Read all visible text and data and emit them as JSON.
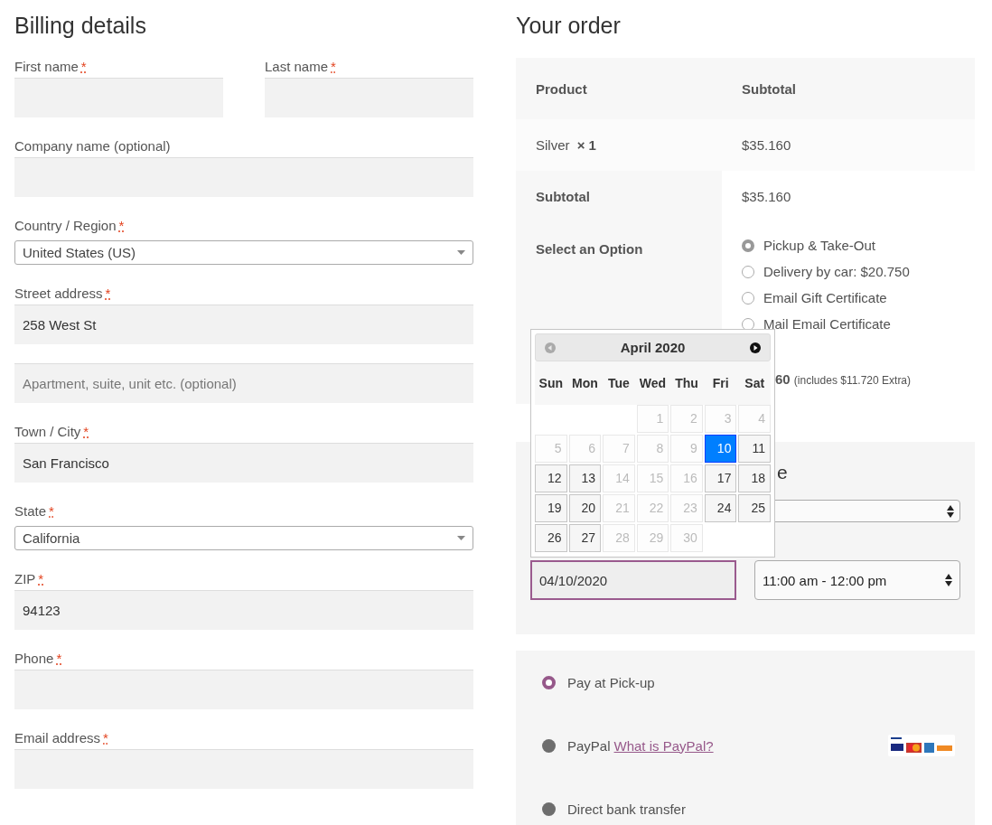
{
  "billing": {
    "title": "Billing details",
    "rows": [
      {
        "fields": [
          {
            "label": "First name",
            "required_mark": "*",
            "kind": "text"
          },
          {
            "label": "Last name",
            "required_mark": "*",
            "kind": "text"
          }
        ]
      },
      {
        "fields": [
          {
            "label": "Company name (optional)",
            "kind": "text"
          }
        ]
      },
      {
        "fields": [
          {
            "label": "Country / Region",
            "required_mark": "*",
            "kind": "select",
            "value": "United States (US)"
          }
        ]
      },
      {
        "fields": [
          {
            "label": "Street address",
            "required_mark": "*",
            "kind": "text",
            "value": "258 West St"
          }
        ]
      },
      {
        "fields": [
          {
            "kind": "text",
            "placeholder": "Apartment, suite, unit etc. (optional)"
          }
        ]
      },
      {
        "fields": [
          {
            "label": "Town / City",
            "required_mark": "*",
            "kind": "text",
            "value": "San Francisco"
          }
        ]
      },
      {
        "fields": [
          {
            "label": "State",
            "required_mark": "*",
            "kind": "select",
            "value": "California"
          }
        ]
      },
      {
        "fields": [
          {
            "label": "ZIP",
            "required_mark": "*",
            "kind": "text",
            "value": "94123"
          }
        ]
      },
      {
        "fields": [
          {
            "label": "Phone",
            "required_mark": "*",
            "kind": "text"
          }
        ]
      },
      {
        "fields": [
          {
            "label": "Email address",
            "required_mark": "*",
            "kind": "text"
          }
        ]
      }
    ]
  },
  "order": {
    "title": "Your order",
    "columns": [
      "Product",
      "Subtotal"
    ],
    "items": [
      {
        "name": "Silver",
        "qty": "× 1",
        "subtotal": "$35.160"
      }
    ],
    "subtotal": {
      "label": "Subtotal",
      "value": "$35.160"
    },
    "shipping": {
      "label": "Select an Option",
      "options": [
        {
          "label": "Pickup & Take-Out",
          "selected": true
        },
        {
          "label": "Delivery by car: $20.750",
          "selected": false
        },
        {
          "label": "Email Gift Certificate",
          "selected": false
        },
        {
          "label": "Mail Email Certificate",
          "selected": false
        }
      ]
    },
    "total": {
      "value": "60",
      "note": "(includes $11.720 Extra)"
    }
  },
  "pickup": {
    "heading": "e",
    "date": "04/10/2020",
    "time": "11:00 am - 12:00 pm"
  },
  "calendar": {
    "title": "April 2020",
    "weekdays": [
      "Sun",
      "Mon",
      "Tue",
      "Wed",
      "Thu",
      "Fri",
      "Sat"
    ],
    "weeks": [
      [
        {
          "day": "1",
          "kind": "disabled"
        },
        {
          "day": "2",
          "kind": "disabled"
        },
        {
          "day": "3",
          "kind": "disabled"
        },
        {
          "day": "4",
          "kind": "disabled"
        }
      ],
      [
        {
          "day": "5",
          "kind": "disabled"
        },
        {
          "day": "6",
          "kind": "disabled"
        },
        {
          "day": "7",
          "kind": "disabled"
        },
        {
          "day": "8",
          "kind": "disabled"
        },
        {
          "day": "9",
          "kind": "disabled"
        },
        {
          "day": "10",
          "kind": "selected"
        },
        {
          "day": "11",
          "kind": "available"
        }
      ],
      [
        {
          "day": "12",
          "kind": "available"
        },
        {
          "day": "13",
          "kind": "available"
        },
        {
          "day": "14",
          "kind": "disabled"
        },
        {
          "day": "15",
          "kind": "disabled"
        },
        {
          "day": "16",
          "kind": "disabled"
        },
        {
          "day": "17",
          "kind": "available"
        },
        {
          "day": "18",
          "kind": "available"
        }
      ],
      [
        {
          "day": "19",
          "kind": "available"
        },
        {
          "day": "20",
          "kind": "available"
        },
        {
          "day": "21",
          "kind": "disabled"
        },
        {
          "day": "22",
          "kind": "disabled"
        },
        {
          "day": "23",
          "kind": "disabled"
        },
        {
          "day": "24",
          "kind": "available"
        },
        {
          "day": "25",
          "kind": "available"
        }
      ],
      [
        {
          "day": "26",
          "kind": "available"
        },
        {
          "day": "27",
          "kind": "available"
        },
        {
          "day": "28",
          "kind": "disabled"
        },
        {
          "day": "29",
          "kind": "disabled"
        },
        {
          "day": "30",
          "kind": "disabled"
        }
      ]
    ]
  },
  "payment": {
    "methods": [
      {
        "label": "Pay at Pick-up",
        "selected": true
      },
      {
        "label": "PayPal",
        "link": "What is PayPal?",
        "selected": false,
        "logos": true
      },
      {
        "label": "Direct bank transfer",
        "selected": false
      }
    ]
  }
}
